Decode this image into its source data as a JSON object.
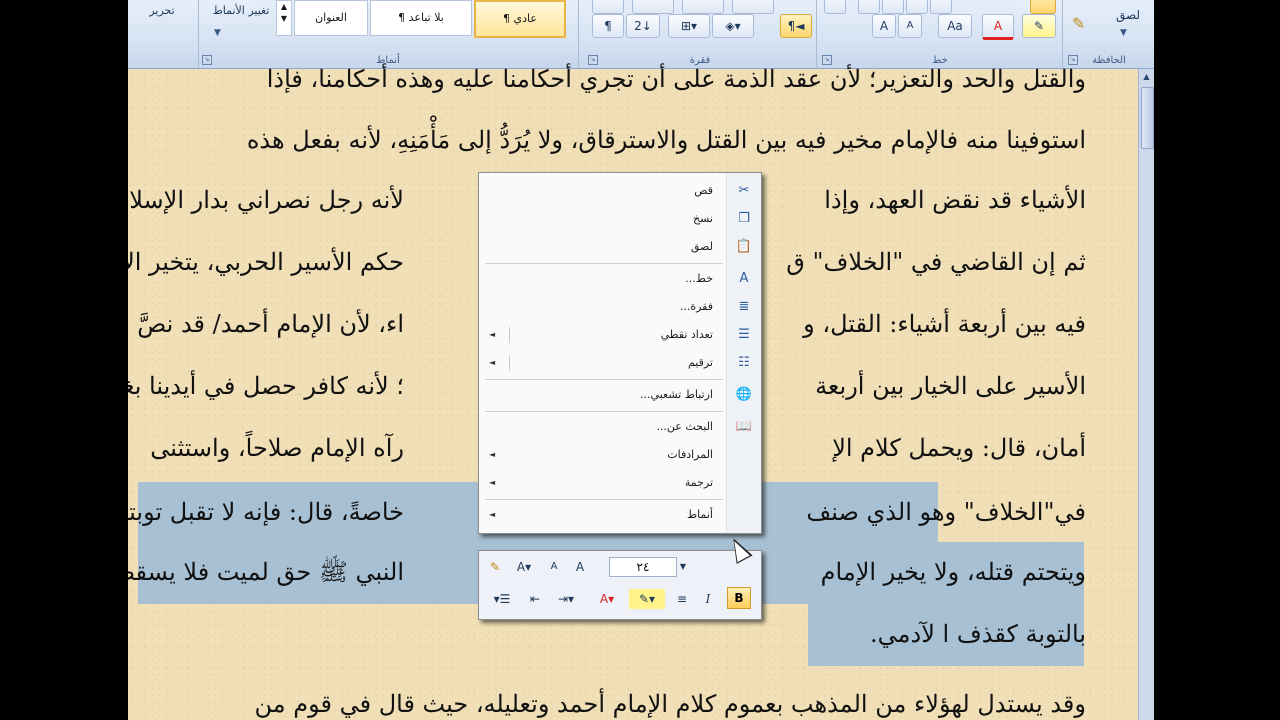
{
  "ribbon": {
    "groups": {
      "clipboard": "الحافظة",
      "font": "خط",
      "paragraph": "فقرة",
      "styles": "أنماط"
    },
    "paste_label": "لصق",
    "edit_label": "تحرير",
    "change_styles_label": "تغيير الأنماط",
    "styles_gallery": [
      "¶ عادي",
      "¶ بلا تباعد",
      "العنوان"
    ],
    "font_buttons": {
      "grow": "A",
      "shrink": "A",
      "change_case": "Aa",
      "font_color": "A",
      "clear": "A"
    },
    "paragraph_buttons": {
      "pilcrow": "¶",
      "sort": "2↓",
      "rtl": "¶◄"
    }
  },
  "document": {
    "lines": [
      "والقتل والحد والتعزير؛ لأن عقد الذمة على أن تجري أحكامنا عليه وهذه أحكامنا، فإذا",
      "استوفينا منه فالإمام مخير فيه بين القتل والاسترقاق، ولا يُرَدُّ إلى مَأْمَنِهِ، لأنه بفعل هذه",
      "الأشياء قد نقض العهد، وإذا",
      "لأنه رجل نصراني بدار الإسلام.",
      "ثم إن القاضي في \"الخلاف\" ق",
      "حكم الأسير الحربي، يتخير الإمام",
      "فيه بين أربعة أشياء: القتل، و",
      "اء، لأن الإمام أحمد/ قد نصَّ في",
      "الأسير على الخيار بين أربعة",
      "؛ لأنه كافر حصل في أيدينا بغير",
      "أمان، قال: ويحمل كلام الإ",
      "رآه الإمام صلاحاً، واستثنى",
      "في\"الخلاف\" وهو الذي صنف",
      "خاصةً، قال: فإنه لا تقبل توبته،",
      "ويتحتم قتله، ولا يخير الإمام",
      "النبي ﷺ حق لميت فلا يسقط",
      "بالتوبة كقذف ا لآدمي.",
      "وقد يستدل لهؤلاء من المذهب بعموم كلام الإمام أحمد وتعليله، حيث قال في قوم من"
    ]
  },
  "context_menu": {
    "items": [
      {
        "label": "قص",
        "icon": "scissors-icon",
        "glyph": "✂"
      },
      {
        "label": "نسخ",
        "icon": "copy-icon",
        "glyph": "❐"
      },
      {
        "label": "لصق",
        "icon": "paste-icon",
        "glyph": "📋"
      },
      {
        "label": "خط...",
        "icon": "font-icon",
        "glyph": "A"
      },
      {
        "label": "فقرة...",
        "icon": "paragraph-icon",
        "glyph": "≣"
      },
      {
        "label": "تعداد نقطي",
        "icon": "bullets-icon",
        "glyph": "☰"
      },
      {
        "label": "ترقيم",
        "icon": "numbering-icon",
        "glyph": "☷"
      },
      {
        "label": "ارتباط تشعبي...",
        "icon": "hyperlink-icon",
        "glyph": "🌐"
      },
      {
        "label": "البحث عن...",
        "icon": "research-icon",
        "glyph": "📖"
      },
      {
        "label": "المرادفات",
        "icon": "",
        "glyph": ""
      },
      {
        "label": "ترجمة",
        "icon": "",
        "glyph": ""
      },
      {
        "label": "أنماط",
        "icon": "",
        "glyph": ""
      }
    ],
    "submenu_arrow": "◄"
  },
  "mini_toolbar": {
    "font_size": "٢٤",
    "bold": "B",
    "italic": "I",
    "grow": "A",
    "shrink": "A"
  },
  "colors": {
    "highlight": "#a8c0d3",
    "paper": "#f1e0b7",
    "ribbon": "#d7e3f3"
  }
}
